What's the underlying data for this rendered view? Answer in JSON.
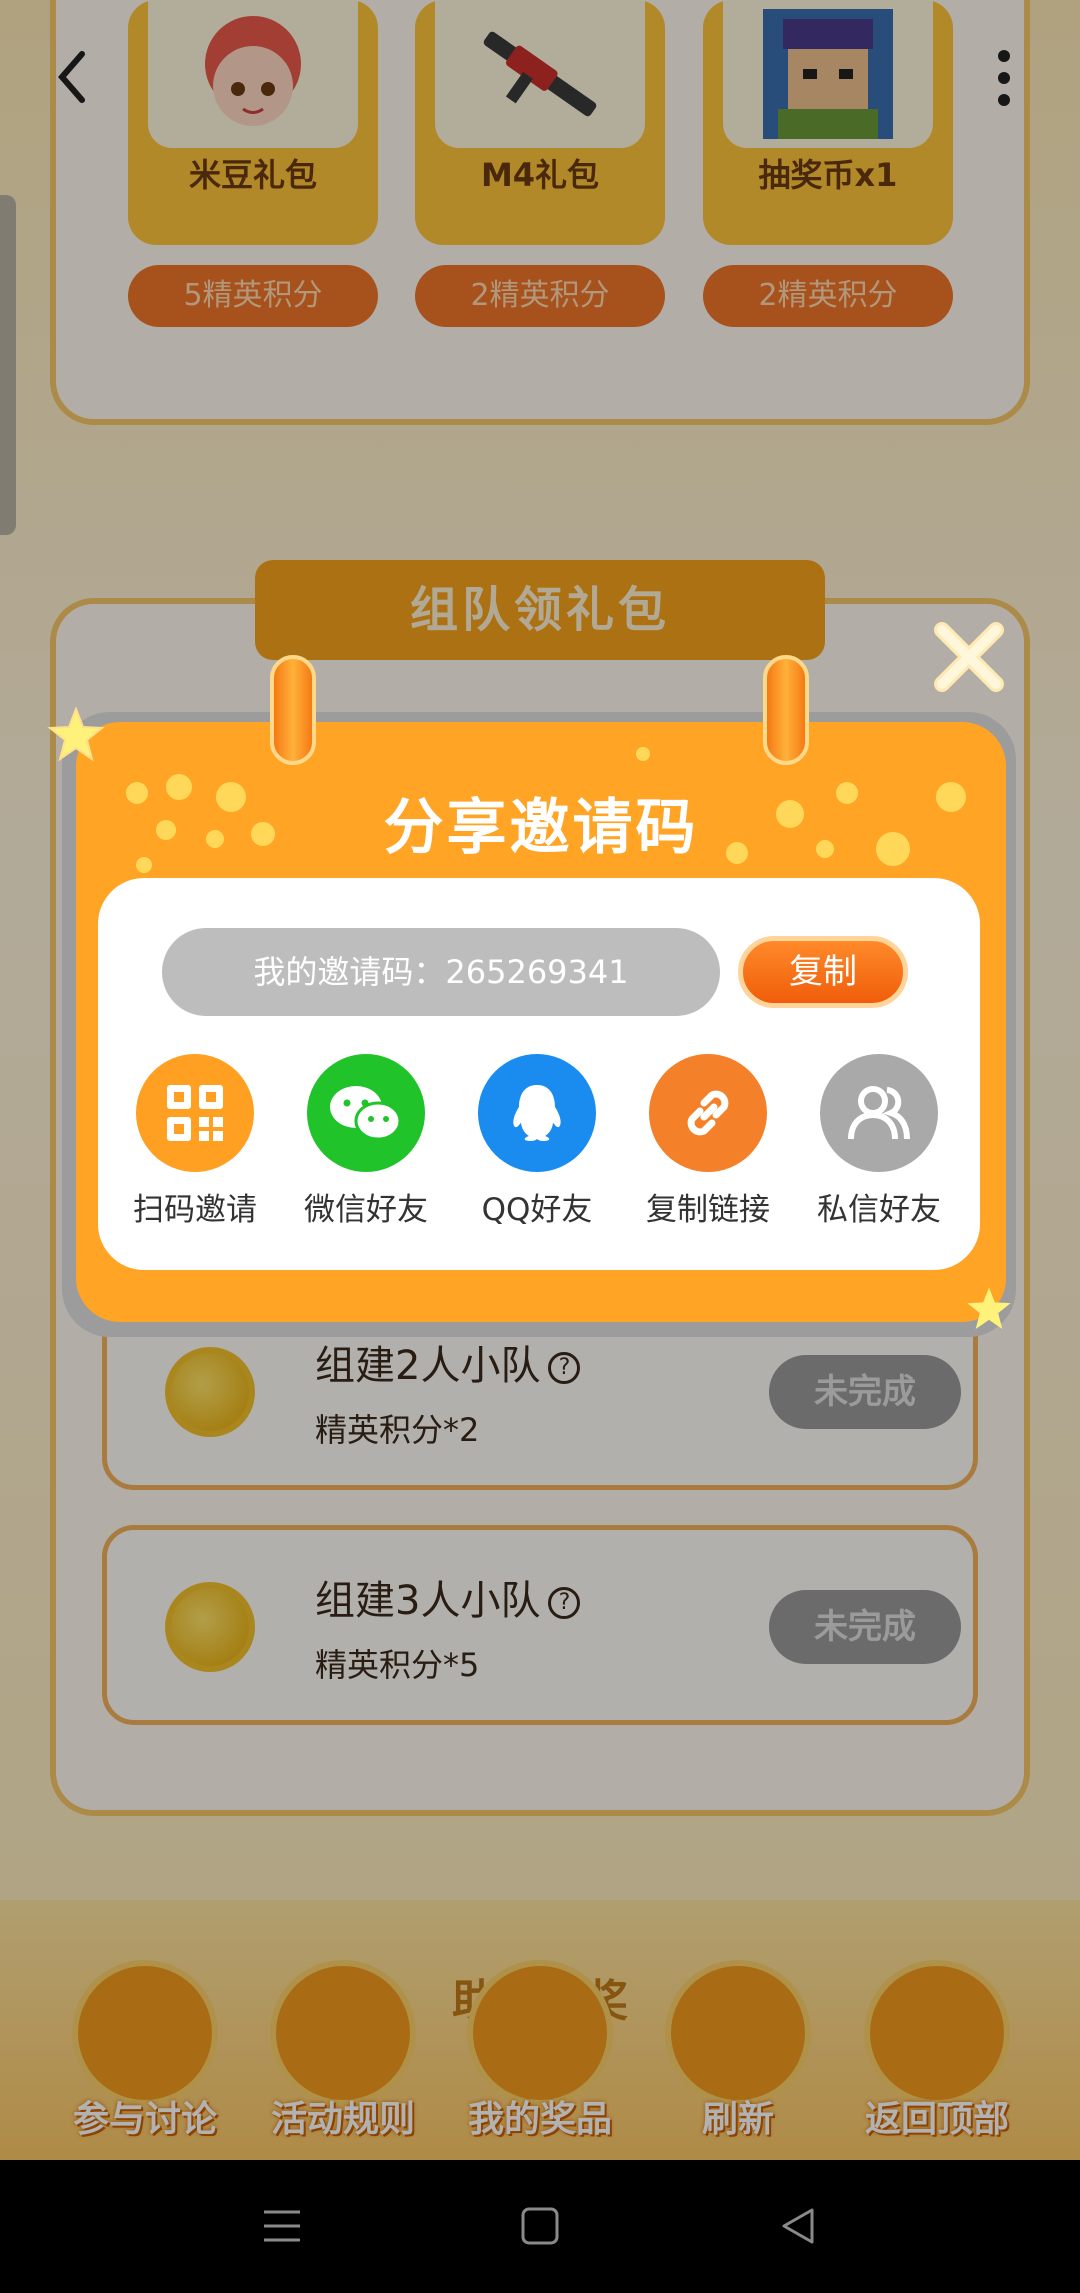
{
  "top_gifts": [
    {
      "name": "米豆礼包",
      "cost": "5精英积分"
    },
    {
      "name": "M4礼包",
      "cost": "2精英积分"
    },
    {
      "name": "抽奖币x1",
      "cost": "2精英积分"
    }
  ],
  "section_title": "组队领礼包",
  "tasks": [
    {
      "title": "组建2人小队",
      "reward": "精英积分*2",
      "status": "未完成"
    },
    {
      "title": "组建3人小队",
      "reward": "精英积分*5",
      "status": "未完成"
    }
  ],
  "help_glyph": "?",
  "bottom_section_title": "助力领奖",
  "bottom_nav": [
    {
      "label": "参与讨论",
      "icon": "chat-icon"
    },
    {
      "label": "活动规则",
      "icon": "star-icon"
    },
    {
      "label": "我的奖品",
      "icon": "gift-icon"
    },
    {
      "label": "刷新",
      "icon": "refresh-icon"
    },
    {
      "label": "返回顶部",
      "icon": "upload-icon"
    }
  ],
  "modal": {
    "title": "分享邀请码",
    "invite_code_text": "我的邀请码：265269341",
    "copy_label": "复制",
    "share_options": [
      {
        "label": "扫码邀请",
        "icon": "qr-code-icon",
        "color": "#ffa022"
      },
      {
        "label": "微信好友",
        "icon": "wechat-icon",
        "color": "#20c32a"
      },
      {
        "label": "QQ好友",
        "icon": "qq-icon",
        "color": "#1a8cf0"
      },
      {
        "label": "复制链接",
        "icon": "link-icon",
        "color": "#f4812a"
      },
      {
        "label": "私信好友",
        "icon": "contacts-icon",
        "color": "#a9a9a9"
      }
    ]
  },
  "colors": {
    "accent_orange": "#ffa425",
    "copy_button": "#f05d0b",
    "disabled_button": "#9a9a9a"
  }
}
